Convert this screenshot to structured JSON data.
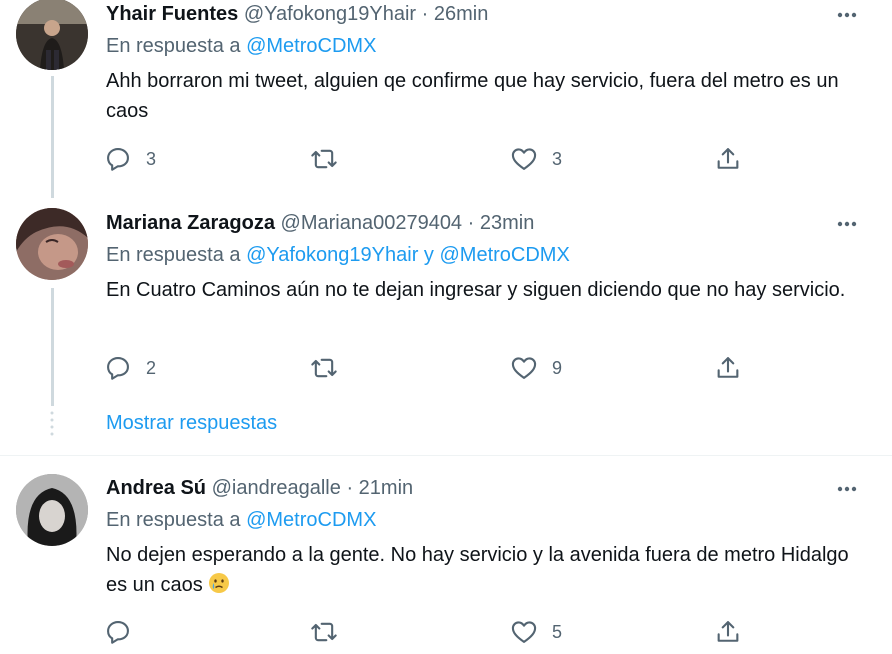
{
  "tweets": [
    {
      "name": "Yhair Fuentes",
      "handle": "@Yafokong19Yhair",
      "time": "26min",
      "reply_prefix": "En respuesta a",
      "mentions": [
        "@MetroCDMX"
      ],
      "text": "Ahh borraron mi tweet, alguien qe confirme que hay servicio, fuera del metro es un caos",
      "replies": "3",
      "retweets": "",
      "likes": "3"
    },
    {
      "name": "Mariana Zaragoza",
      "handle": "@Mariana00279404",
      "time": "23min",
      "reply_prefix": "En respuesta a",
      "mentions": [
        "@Yafokong19Yhair",
        "@MetroCDMX"
      ],
      "mention_joiner": "y",
      "text": "En Cuatro Caminos aún no te dejan ingresar y siguen diciendo que no hay servicio.",
      "replies": "2",
      "retweets": "",
      "likes": "9"
    },
    {
      "name": "Andrea Sú",
      "handle": "@iandreagalle",
      "time": "21min",
      "reply_prefix": "En respuesta a",
      "mentions": [
        "@MetroCDMX"
      ],
      "text": "No dejen esperando a la gente. No hay servicio y la avenida fuera de metro Hidalgo es un caos",
      "emoji": "crying-face-emoji",
      "replies": "",
      "retweets": "",
      "likes": "5"
    }
  ],
  "show_replies_label": "Mostrar respuestas",
  "separator_dot": "·",
  "icons": {
    "reply": "reply-icon",
    "retweet": "retweet-icon",
    "like": "heart-icon",
    "share": "share-icon",
    "more": "more-options-icon"
  },
  "colors": {
    "accent": "#1d9bf0",
    "secondary_text": "#536471",
    "thread_line": "#cfd9de"
  }
}
